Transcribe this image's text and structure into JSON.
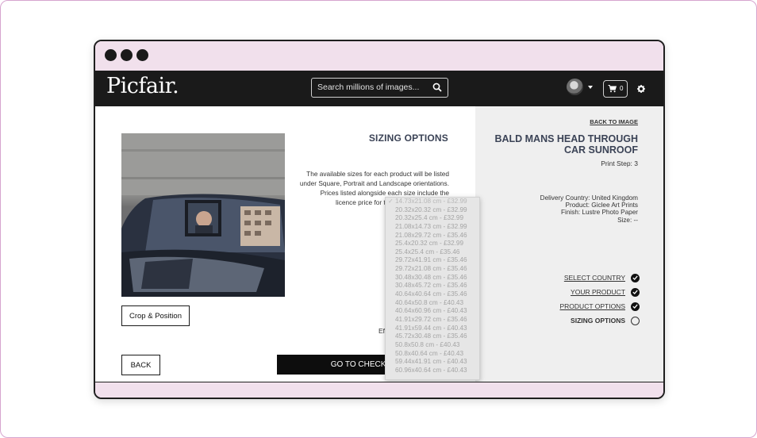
{
  "header": {
    "logo": "Picfair.",
    "search_placeholder": "Search millions of images...",
    "cart_count": "0"
  },
  "main": {
    "sizing_title": "SIZING OPTIONS",
    "description": "The available sizes for each product will be listed under Square, Portrait and Landscape orientations. Prices listed alongside each size include the licence price for the chosen image calc",
    "crop_button": "Crop & Position",
    "back_button": "BACK",
    "checkout_button": "GO TO CHECKO",
    "ef_text": "Ef"
  },
  "dropdown": {
    "options": [
      "14.73x21.08 cm - £32.99",
      "20.32x20.32 cm - £32.99",
      "20.32x25.4 cm - £32.99",
      "21.08x14.73 cm - £32.99",
      "21.08x29.72 cm - £35.46",
      "25.4x20.32 cm - £32.99",
      "25.4x25.4 cm - £35.46",
      "29.72x41.91 cm - £35.46",
      "29.72x21.08 cm - £35.46",
      "30.48x30.48 cm - £35.46",
      "30.48x45.72 cm - £35.46",
      "40.64x40.64 cm - £35.46",
      "40.64x50.8 cm - £40.43",
      "40.64x60.96 cm - £40.43",
      "41.91x29.72 cm - £35.46",
      "41.91x59.44 cm - £40.43",
      "45.72x30.48 cm - £35.46",
      "50.8x50.8 cm - £40.43",
      "50.8x40.64 cm - £40.43",
      "59.44x41.91 cm - £40.43",
      "60.96x40.64 cm - £40.43"
    ],
    "selected_mark": "✓"
  },
  "sidebar": {
    "back_link": "BACK TO IMAGE",
    "product_title": "BALD MANS HEAD THROUGH CAR SUNROOF",
    "print_step": "Print Step: 3",
    "delivery_country": "Delivery Country: United Kingdom",
    "product": "Product: Giclee Art Prints",
    "finish": "Finish: Lustre Photo Paper",
    "size": "Size: --",
    "steps": [
      {
        "label": "SELECT COUNTRY",
        "state": "done"
      },
      {
        "label": "YOUR PRODUCT",
        "state": "done"
      },
      {
        "label": "PRODUCT OPTIONS",
        "state": "done"
      },
      {
        "label": "SIZING OPTIONS",
        "state": "current"
      }
    ]
  }
}
